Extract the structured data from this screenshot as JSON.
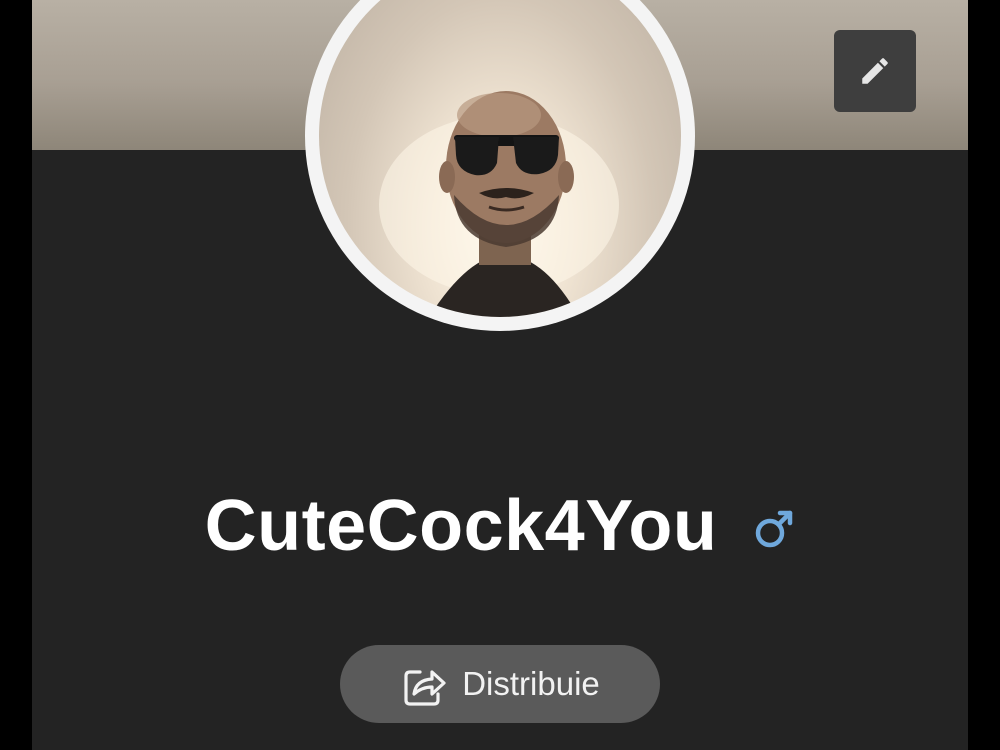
{
  "profile": {
    "username": "CuteCock4You",
    "gender_icon": "male-symbol-icon",
    "avatar": "profile-photo"
  },
  "actions": {
    "edit_icon": "pencil-icon",
    "share_label": "Distribuie",
    "share_icon": "share-icon"
  },
  "colors": {
    "page_background": "#000000",
    "card_background": "#232323",
    "button_background": "#5a5a5a",
    "edit_button_background": "#3e3e3e",
    "gender_accent": "#6fa8dc",
    "text": "#ffffff"
  }
}
